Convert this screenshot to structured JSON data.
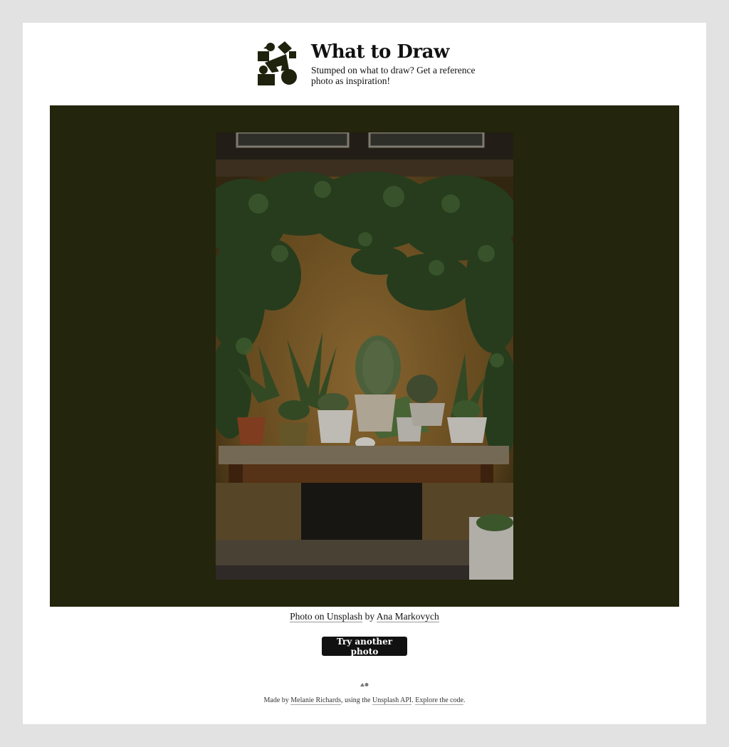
{
  "header": {
    "title": "What to Draw",
    "subtitle": "Stumped on what to draw? Get a reference photo as inspiration!",
    "logo_icon": "geometric-shapes-icon"
  },
  "stage": {
    "background_color": "#23250c",
    "photo_alt": "Potted cacti and succulents on a wooden table against an ochre wall with vines"
  },
  "credit": {
    "photo_link": "Photo on Unsplash",
    "by": " by ",
    "author_link": "Ana Markovych"
  },
  "button": {
    "label": "Try another photo"
  },
  "footer": {
    "made_by": "Made by ",
    "author_link": "Melanie Richards",
    "using": ", using the ",
    "api_link": "Unsplash API",
    "sep": ". ",
    "code_link": "Explore the code",
    "end": "."
  },
  "colors": {
    "accent": "#1f220c",
    "button_bg": "#111111",
    "page_bg": "#e2e2e2"
  }
}
